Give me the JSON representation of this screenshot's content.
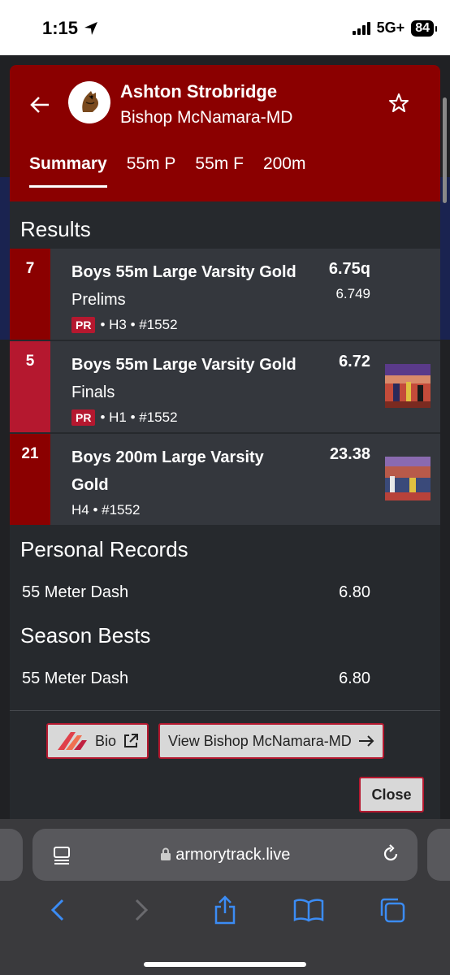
{
  "status": {
    "time": "1:15",
    "network": "5G+",
    "battery": "84"
  },
  "header": {
    "athlete_name": "Ashton Strobridge",
    "school": "Bishop McNamara-MD",
    "tabs": [
      "Summary",
      "55m P",
      "55m F",
      "200m"
    ],
    "active_tab": "Summary"
  },
  "results": {
    "title": "Results",
    "items": [
      {
        "rank": "7",
        "event_bold": "Boys 55m Large Varsity Gold",
        "event_rest": " Prelims",
        "pr": "PR",
        "meta": "• H3 • #1552",
        "mark": "6.75q",
        "mark_sub": "6.749"
      },
      {
        "rank": "5",
        "event_bold": "Boys 55m Large Varsity Gold",
        "event_rest": " Finals",
        "pr": "PR",
        "meta": "• H1 • #1552",
        "mark": "6.72",
        "mark_sub": ""
      },
      {
        "rank": "21",
        "event_bold": "Boys 200m Large Varsity Gold",
        "event_rest": "",
        "pr": "",
        "meta": "H4 • #1552",
        "mark": "23.38",
        "mark_sub": ""
      }
    ]
  },
  "personal_records": {
    "title": "Personal Records",
    "event": "55 Meter Dash",
    "mark": "6.80"
  },
  "season_bests": {
    "title": "Season Bests",
    "event": "55 Meter Dash",
    "mark": "6.80"
  },
  "actions": {
    "bio": "Bio",
    "view_school": "View Bishop McNamara-MD",
    "close": "Close"
  },
  "browser": {
    "url": "armorytrack.live"
  }
}
